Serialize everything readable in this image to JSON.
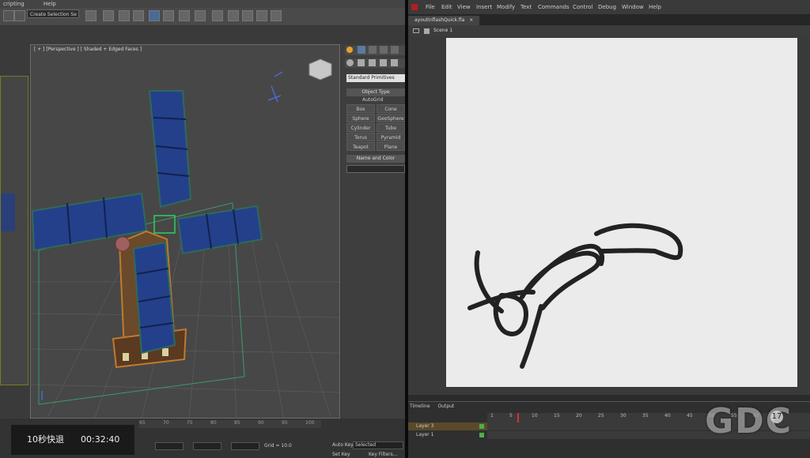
{
  "max": {
    "menu": [
      "cripting",
      "Help"
    ],
    "selection_dropdown": "Create Selection Se",
    "viewport_label": "[ + ] [Perspective ] [ Shaded + Edged Faces ]",
    "command_panel": {
      "category": "Standard Primitives",
      "object_type_title": "Object Type",
      "autogrid": "AutoGrid",
      "buttons": [
        "Box",
        "Cone",
        "Sphere",
        "GeoSphere",
        "Cylinder",
        "Tube",
        "Torus",
        "Pyramid",
        "Teapot",
        "Plane"
      ],
      "name_color_title": "Name and Color"
    },
    "status": {
      "grid": "Grid = 10.0",
      "auto_key": "Auto Key",
      "selected": "Selected",
      "set_key": "Set Key",
      "key_filters": "Key Filters...",
      "ruler": [
        "65",
        "70",
        "75",
        "80",
        "85",
        "90",
        "95",
        "100"
      ]
    }
  },
  "video": {
    "rewind_label": "10秒快退",
    "time": "00:32:40"
  },
  "flash": {
    "menu": [
      "File",
      "Edit",
      "View",
      "Insert",
      "Modify",
      "Text",
      "Commands",
      "Control",
      "Debug",
      "Window",
      "Help"
    ],
    "doc_tab": "ayoutInflashQuick.fla",
    "doc_tab_close": "×",
    "scene": "Scene 1",
    "timeline_tabs": [
      "Timeline",
      "Output"
    ],
    "ruler": [
      "1",
      "5",
      "10",
      "15",
      "20",
      "25",
      "30",
      "35",
      "40",
      "45",
      "50",
      "55",
      "60"
    ],
    "layers": [
      "Layer 3",
      "Layer 1"
    ],
    "colors": {
      "stage": "#ebebeb",
      "stroke": "#222222",
      "layer_highlight": "#5a4a2a"
    }
  },
  "watermark": {
    "text": "GDC",
    "number": "17"
  }
}
